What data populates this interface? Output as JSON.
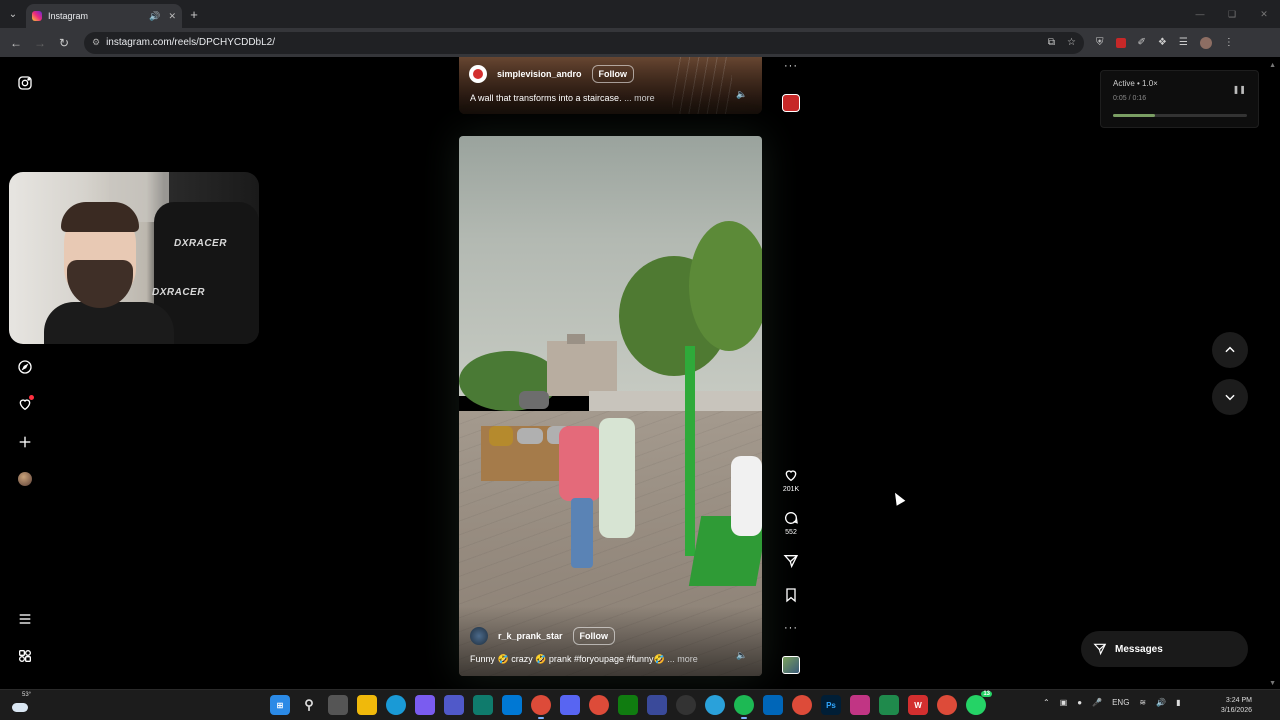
{
  "browser": {
    "tab_title": "Instagram",
    "url": "instagram.com/reels/DPCHYCDDbL2/"
  },
  "colors": {
    "follow_border": "#8e8e8e",
    "notification": "#ff3040",
    "progress_fill": "#7a9e63",
    "pole_green": "#2faa3a"
  },
  "sidebar": {
    "icons": [
      "instagram-logo-icon",
      "explore-icon",
      "notifications-heart-icon",
      "create-plus-icon",
      "profile-avatar",
      "more-menu-icon",
      "also-from-meta-icon"
    ]
  },
  "webcam": {
    "chair_brand": "DXRACER"
  },
  "reel_prev": {
    "username": "simplevision_andro",
    "follow_label": "Follow",
    "caption": "A wall that transforms into a staircase.",
    "more_label": "... more"
  },
  "reel_current": {
    "username": "r_k_prank_star",
    "follow_label": "Follow",
    "caption": "Funny 🤣 crazy 🤣 prank #foryoupage #funny🤣",
    "more_label": "... more",
    "likes": "201K",
    "comments": "552"
  },
  "speed_panel": {
    "status": "Active • 1.0×",
    "time": "0:05 / 0:16",
    "progress": 0.3125
  },
  "messages": {
    "label": "Messages"
  },
  "taskbar": {
    "temperature": "53°",
    "language": "ENG",
    "time": "3:24 PM",
    "date": "3/16/2026",
    "whatsapp_badge": "13"
  }
}
